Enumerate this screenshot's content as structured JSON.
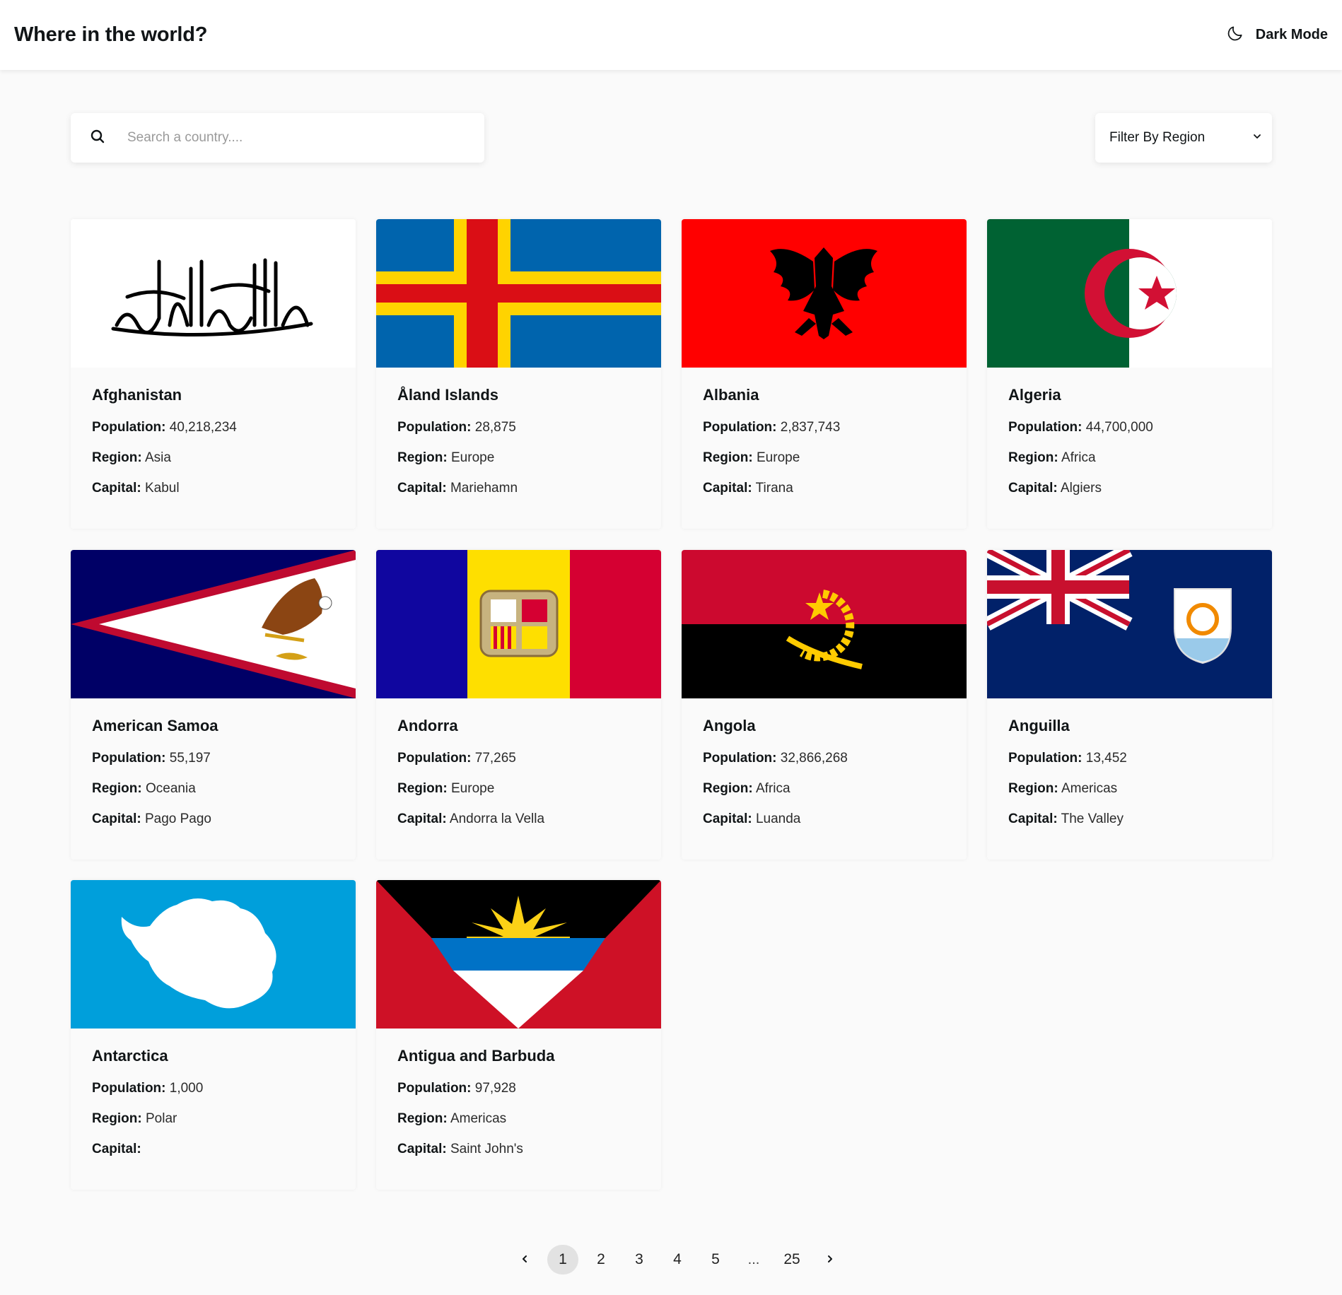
{
  "header": {
    "title": "Where in the world?",
    "theme_toggle_label": "Dark Mode"
  },
  "search": {
    "placeholder": "Search a country....",
    "value": ""
  },
  "filter": {
    "label": "Filter By Region"
  },
  "labels": {
    "population": "Population:",
    "region": "Region:",
    "capital": "Capital:"
  },
  "countries": [
    {
      "name": "Afghanistan",
      "population": "40,218,234",
      "region": "Asia",
      "capital": "Kabul"
    },
    {
      "name": "Åland Islands",
      "population": "28,875",
      "region": "Europe",
      "capital": "Mariehamn"
    },
    {
      "name": "Albania",
      "population": "2,837,743",
      "region": "Europe",
      "capital": "Tirana"
    },
    {
      "name": "Algeria",
      "population": "44,700,000",
      "region": "Africa",
      "capital": "Algiers"
    },
    {
      "name": "American Samoa",
      "population": "55,197",
      "region": "Oceania",
      "capital": "Pago Pago"
    },
    {
      "name": "Andorra",
      "population": "77,265",
      "region": "Europe",
      "capital": "Andorra la Vella"
    },
    {
      "name": "Angola",
      "population": "32,866,268",
      "region": "Africa",
      "capital": "Luanda"
    },
    {
      "name": "Anguilla",
      "population": "13,452",
      "region": "Americas",
      "capital": "The Valley"
    },
    {
      "name": "Antarctica",
      "population": "1,000",
      "region": "Polar",
      "capital": ""
    },
    {
      "name": "Antigua and Barbuda",
      "population": "97,928",
      "region": "Americas",
      "capital": "Saint John's"
    }
  ],
  "pagination": {
    "pages": [
      "1",
      "2",
      "3",
      "4",
      "5"
    ],
    "ellipsis": "...",
    "last": "25",
    "current": "1"
  },
  "colors": {
    "background": "#fafafa",
    "card": "#fafafa",
    "text": "#111517",
    "active_page": "#e2e2e2"
  }
}
